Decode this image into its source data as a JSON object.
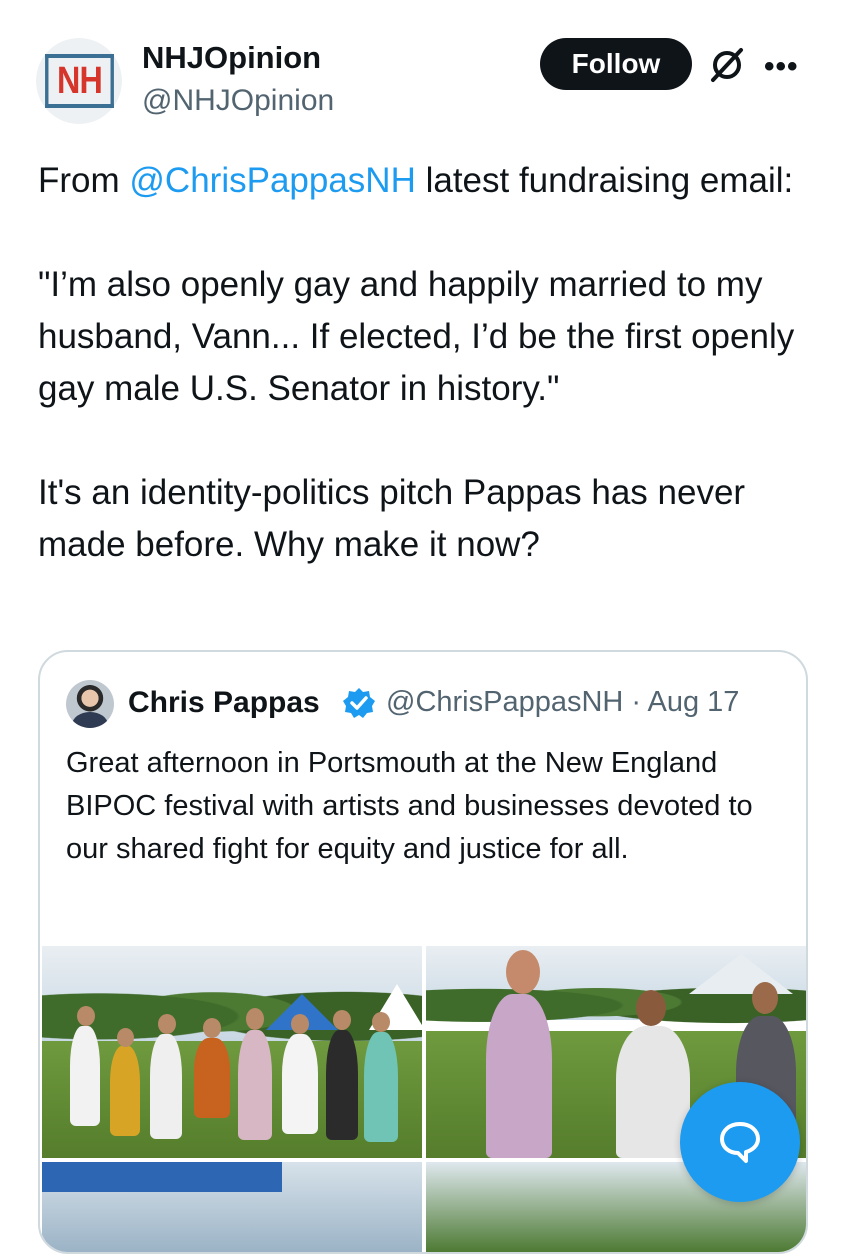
{
  "author": {
    "display_name": "NHJOpinion",
    "handle": "@NHJOpinion",
    "avatar_text": "NH"
  },
  "header": {
    "follow_label": "Follow",
    "grok_icon": "grok-icon",
    "more_icon": "more-icon",
    "more_glyph": "•••"
  },
  "tweet": {
    "line1_prefix": "From ",
    "mention": "@ChrisPappasNH",
    "line1_suffix": " latest fundraising email:",
    "quote_text": "\"I’m also openly gay and happily married to my husband, Vann... If elected, I’d be the first openly gay male U.S. Senator in history.\"",
    "closing_text": "It's an identity-politics pitch Pappas has never made before. Why make it now?"
  },
  "quoted_tweet": {
    "display_name": "Chris Pappas",
    "verified": true,
    "handle_date": "@ChrisPappasNH · Aug 17",
    "text": "Great afternoon in Portsmouth at the New England BIPOC festival with artists and businesses devoted to our shared fight for equity and justice for all."
  },
  "colors": {
    "accent": "#1d9bf0",
    "text": "#0f1419",
    "secondary": "#536471",
    "border": "#cfd9de"
  },
  "fab": {
    "icon": "chat-bubble-icon"
  }
}
